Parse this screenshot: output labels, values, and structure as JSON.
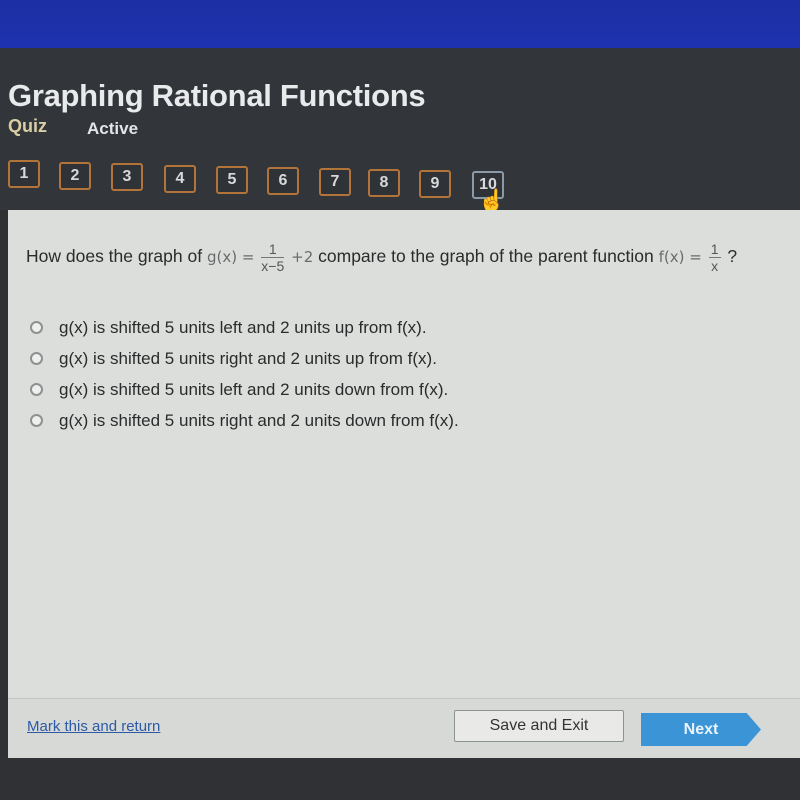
{
  "header": {
    "title": "Graphing Rational Functions",
    "type_label": "Quiz",
    "status": "Active"
  },
  "question_nav": {
    "items": [
      "1",
      "2",
      "3",
      "4",
      "5",
      "6",
      "7",
      "8",
      "9",
      "10"
    ],
    "current": "10"
  },
  "question": {
    "prefix": "How does the graph of",
    "g_label": "g(x) =",
    "g_num": "1",
    "g_den": "x−5",
    "g_suffix": "+2",
    "middle": "compare to the graph of the parent function",
    "f_label": "f(x) =",
    "f_num": "1",
    "f_den": "x",
    "end": "?"
  },
  "options": [
    "g(x) is shifted 5 units left and 2 units up from f(x).",
    "g(x) is shifted 5 units right and 2 units up from f(x).",
    "g(x) is shifted 5 units left and 2 units down from f(x).",
    "g(x) is shifted 5 units right and 2 units down from f(x)."
  ],
  "footer": {
    "mark_link": "Mark this and return",
    "save_label": "Save and Exit",
    "next_label": "Next"
  },
  "colors": {
    "topbar": "#1e32b0",
    "nav_border": "#b3743a",
    "next_button": "#3a94d6",
    "link": "#2d5aa6"
  }
}
